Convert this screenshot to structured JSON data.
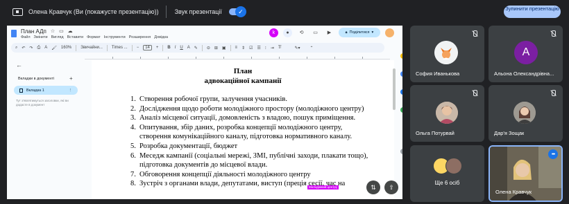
{
  "topbar": {
    "presenter_title": "Олена Кравчук (Ви (покажусте презентацію))",
    "sound_label": "Звук презентації",
    "sound_enabled": true,
    "stop_button": "Зупинити презентацію"
  },
  "doc": {
    "title": "План АДп",
    "menu": [
      "Файл",
      "Змінити",
      "Вигляд",
      "Вставити",
      "Формат",
      "Інструменти",
      "Розширення",
      "Довідка"
    ],
    "share_label": "Поділитися",
    "toolbar": {
      "zoom": "160%",
      "style": "Звичайни...",
      "font": "Times ...",
      "font_size": "14"
    },
    "sidebar": {
      "tabs_heading": "Вкладки в документі",
      "active_tab": "Вкладка 1",
      "hint": "Тут з'являтимуться заголовки, які ви додасте в документ"
    },
    "page": {
      "title_line1": "План",
      "title_line2": "адвокаційної кампанії",
      "items": [
        {
          "num": "1.",
          "text": "Створення робочої групи, залучення учасників."
        },
        {
          "num": "2.",
          "text": "Дослідження щодо роботи молодіжного простору (молодіжного центру)"
        },
        {
          "num": "3.",
          "text": "Аналіз місцевої ситуації, домовленість з владою, пошук приміщення."
        },
        {
          "num": "4.",
          "text": "Опитування, збір даних, розробка концепції молодіжного центру, створення комунікаційного каналу, підготовка нормативного каналу."
        },
        {
          "num": "5.",
          "text": "Розробка документації, бюджет"
        },
        {
          "num": "6.",
          "text": "Меседж кампанії (соціальні мережі, ЗМІ, публічні заходи, плакати тощо), підготовка документів до місцевої влади."
        },
        {
          "num": "7.",
          "text": "Обговорення концепції діяльності молодіжного центру"
        },
        {
          "num": "8.",
          "text": "Зустріч з органами влади, депутатами, виступ (преція сесії, час на"
        }
      ],
      "cursor_tag": "Молодіжний центру"
    }
  },
  "participants": [
    {
      "name": "София Иванькова",
      "muted": true
    },
    {
      "name": "Альона Олександрівна...",
      "initial": "А",
      "muted": true
    },
    {
      "name": "Ольга Потурвай",
      "muted": true
    },
    {
      "name": "Дар'я Зощак",
      "muted": true
    },
    {
      "name": "Ще 6 осіб"
    },
    {
      "name": "Олена Кравчук",
      "speaking": true
    }
  ],
  "colors": {
    "background": "#202124",
    "tile": "#3c4043",
    "accent": "#8ab4f8",
    "share_button": "#c2e7ff",
    "avatar_purple": "#7b1fa2"
  }
}
